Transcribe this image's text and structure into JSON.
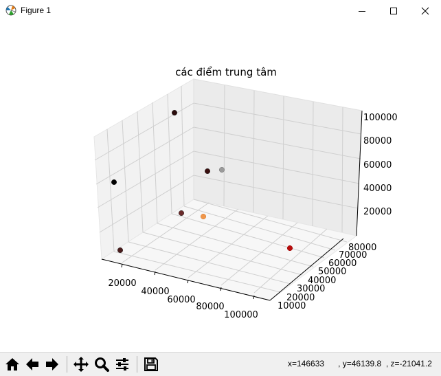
{
  "window": {
    "title": "Figure 1",
    "icon": "matplotlib-icon"
  },
  "window_controls": [
    "minimize-icon",
    "maximize-icon",
    "close-icon"
  ],
  "chart_data": {
    "type": "scatter",
    "title": "các điểm trung tâm",
    "x_ticks": [
      "20000",
      "40000",
      "60000",
      "80000",
      "100000"
    ],
    "y_ticks": [
      "10000",
      "20000",
      "30000",
      "40000",
      "50000",
      "60000",
      "70000",
      "80000"
    ],
    "z_ticks": [
      "20000",
      "40000",
      "60000",
      "80000",
      "100000"
    ],
    "grid": true
  },
  "toolbar": {
    "buttons": [
      {
        "name": "home-button",
        "icon": "home-icon"
      },
      {
        "name": "back-button",
        "icon": "back-arrow-icon"
      },
      {
        "name": "forward-button",
        "icon": "forward-arrow-icon"
      },
      {
        "name": "pan-button",
        "icon": "pan-move-icon"
      },
      {
        "name": "zoom-button",
        "icon": "zoom-magnifier-icon"
      },
      {
        "name": "configure-subplots-button",
        "icon": "sliders-icon"
      },
      {
        "name": "save-button",
        "icon": "floppy-disk-icon"
      }
    ]
  },
  "status": {
    "x": "x=146633",
    "y": ", y=46139.8",
    "z": ", z=-21041.2"
  }
}
